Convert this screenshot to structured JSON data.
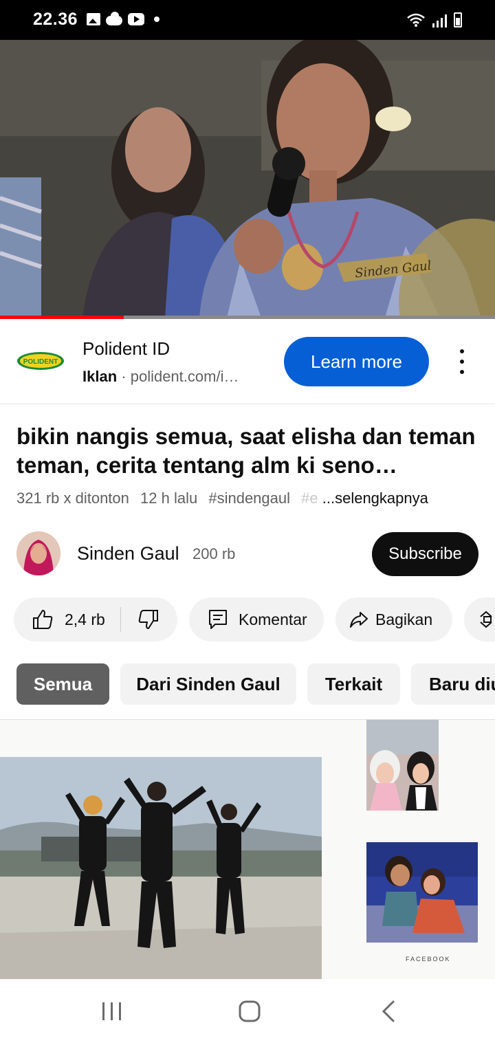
{
  "status_bar": {
    "time": "22.36"
  },
  "video_player": {
    "watermark": "Sinden Gaul",
    "progress": 0.25
  },
  "ad": {
    "advertiser": "Polident ID",
    "logo_text": "POLIDENT",
    "label": "Iklan",
    "separator": "·",
    "url": "polident.com/i…",
    "cta": "Learn more"
  },
  "video": {
    "title": "bikin nangis semua, saat elisha dan teman teman, cerita tentang alm ki seno…",
    "views": "321 rb x ditonton",
    "age": "12 h lalu",
    "hashtag": "#sindengaul",
    "hashtag_faded": "#e",
    "more": "...selengkapnya"
  },
  "channel": {
    "name": "Sinden Gaul",
    "subscribers": "200 rb",
    "subscribe_label": "Subscribe"
  },
  "actions": {
    "likes": "2,4 rb",
    "comment_label": "Komentar",
    "share_label": "Bagikan"
  },
  "chips": [
    {
      "label": "Semua",
      "active": true
    },
    {
      "label": "Dari Sinden Gaul",
      "active": false
    },
    {
      "label": "Terkait",
      "active": false
    },
    {
      "label": "Baru diu",
      "active": false
    }
  ],
  "preview": {
    "tag": "FACEBOOK"
  },
  "colors": {
    "accent_blue": "#065fd4",
    "progress_red": "#ff0000",
    "chip_active": "#606060"
  }
}
